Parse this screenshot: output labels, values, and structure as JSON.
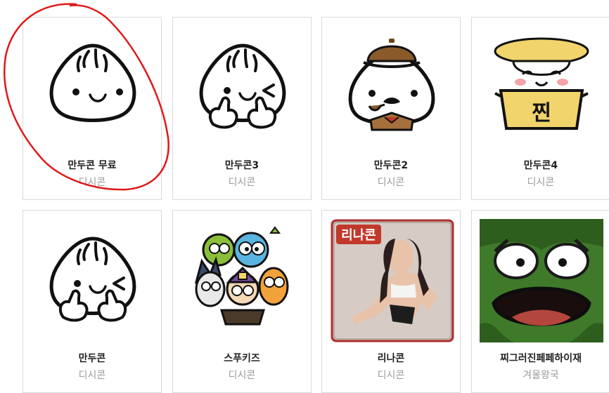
{
  "cards": [
    {
      "name": "만두콘 무료",
      "maker": "디시콘",
      "icon": "mandu-smile-icon"
    },
    {
      "name": "만두콘3",
      "maker": "디시콘",
      "icon": "mandu-wink-thumbs-icon"
    },
    {
      "name": "만두콘2",
      "maker": "디시콘",
      "icon": "mandu-detective-icon"
    },
    {
      "name": "만두콘4",
      "maker": "디시콘",
      "icon": "mandu-steamer-icon"
    },
    {
      "name": "만두콘",
      "maker": "디시콘",
      "icon": "mandu-wink-thumbs-icon"
    },
    {
      "name": "스푸키즈",
      "maker": "디시콘",
      "icon": "spookids-monsters-icon"
    },
    {
      "name": "리나콘",
      "maker": "디시콘",
      "icon": "rina-photo-icon",
      "badge": "리나콘"
    },
    {
      "name": "찌그러진페페하이재",
      "maker": "겨울왕국",
      "icon": "pepe-screaming-icon"
    }
  ],
  "steamer_label": "찐",
  "colors": {
    "annotation": "#e01818",
    "border": "#d9d9d9",
    "maker": "#9a9a9a",
    "badge": "#c0392b"
  }
}
